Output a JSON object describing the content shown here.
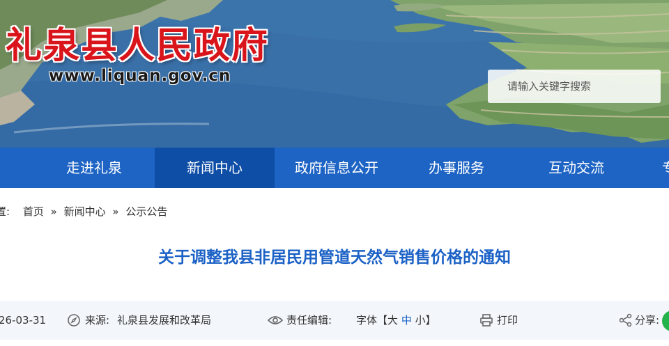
{
  "header": {
    "site_title": "礼泉县人民政府",
    "site_url": "www.liquan.gov.cn",
    "search": {
      "placeholder": "请输入关键字搜索",
      "value": ""
    }
  },
  "nav": {
    "items": [
      {
        "label": "走进礼泉",
        "active": false
      },
      {
        "label": "新闻中心",
        "active": true
      },
      {
        "label": "政府信息公开",
        "active": false
      },
      {
        "label": "办事服务",
        "active": false
      },
      {
        "label": "互动交流",
        "active": false
      },
      {
        "label": "专",
        "active": false
      }
    ]
  },
  "breadcrumb": {
    "prefix": "置:",
    "items": [
      "首页",
      "新闻中心",
      "公示公告"
    ],
    "separator": "»"
  },
  "article": {
    "title": "关于调整我县非居民用管道天然气销售价格的通知",
    "meta": {
      "date": "26-03-31",
      "source_label": "来源:",
      "source_value": "礼泉县发展和改革局",
      "editor_label": "责任编辑:",
      "editor_value": "",
      "font_label": "字体【",
      "font_large": "大",
      "font_medium": "中",
      "font_small": "小",
      "font_close": "】",
      "print_label": "打印",
      "share_label": "分享:"
    }
  },
  "colors": {
    "nav_bg": "#1e64c4",
    "nav_active": "#0f4ea7",
    "title_red": "#d9141a",
    "article_title_blue": "#1b61c6",
    "meta_bg": "#f3f7fb",
    "wechat_green": "#24b24b"
  }
}
